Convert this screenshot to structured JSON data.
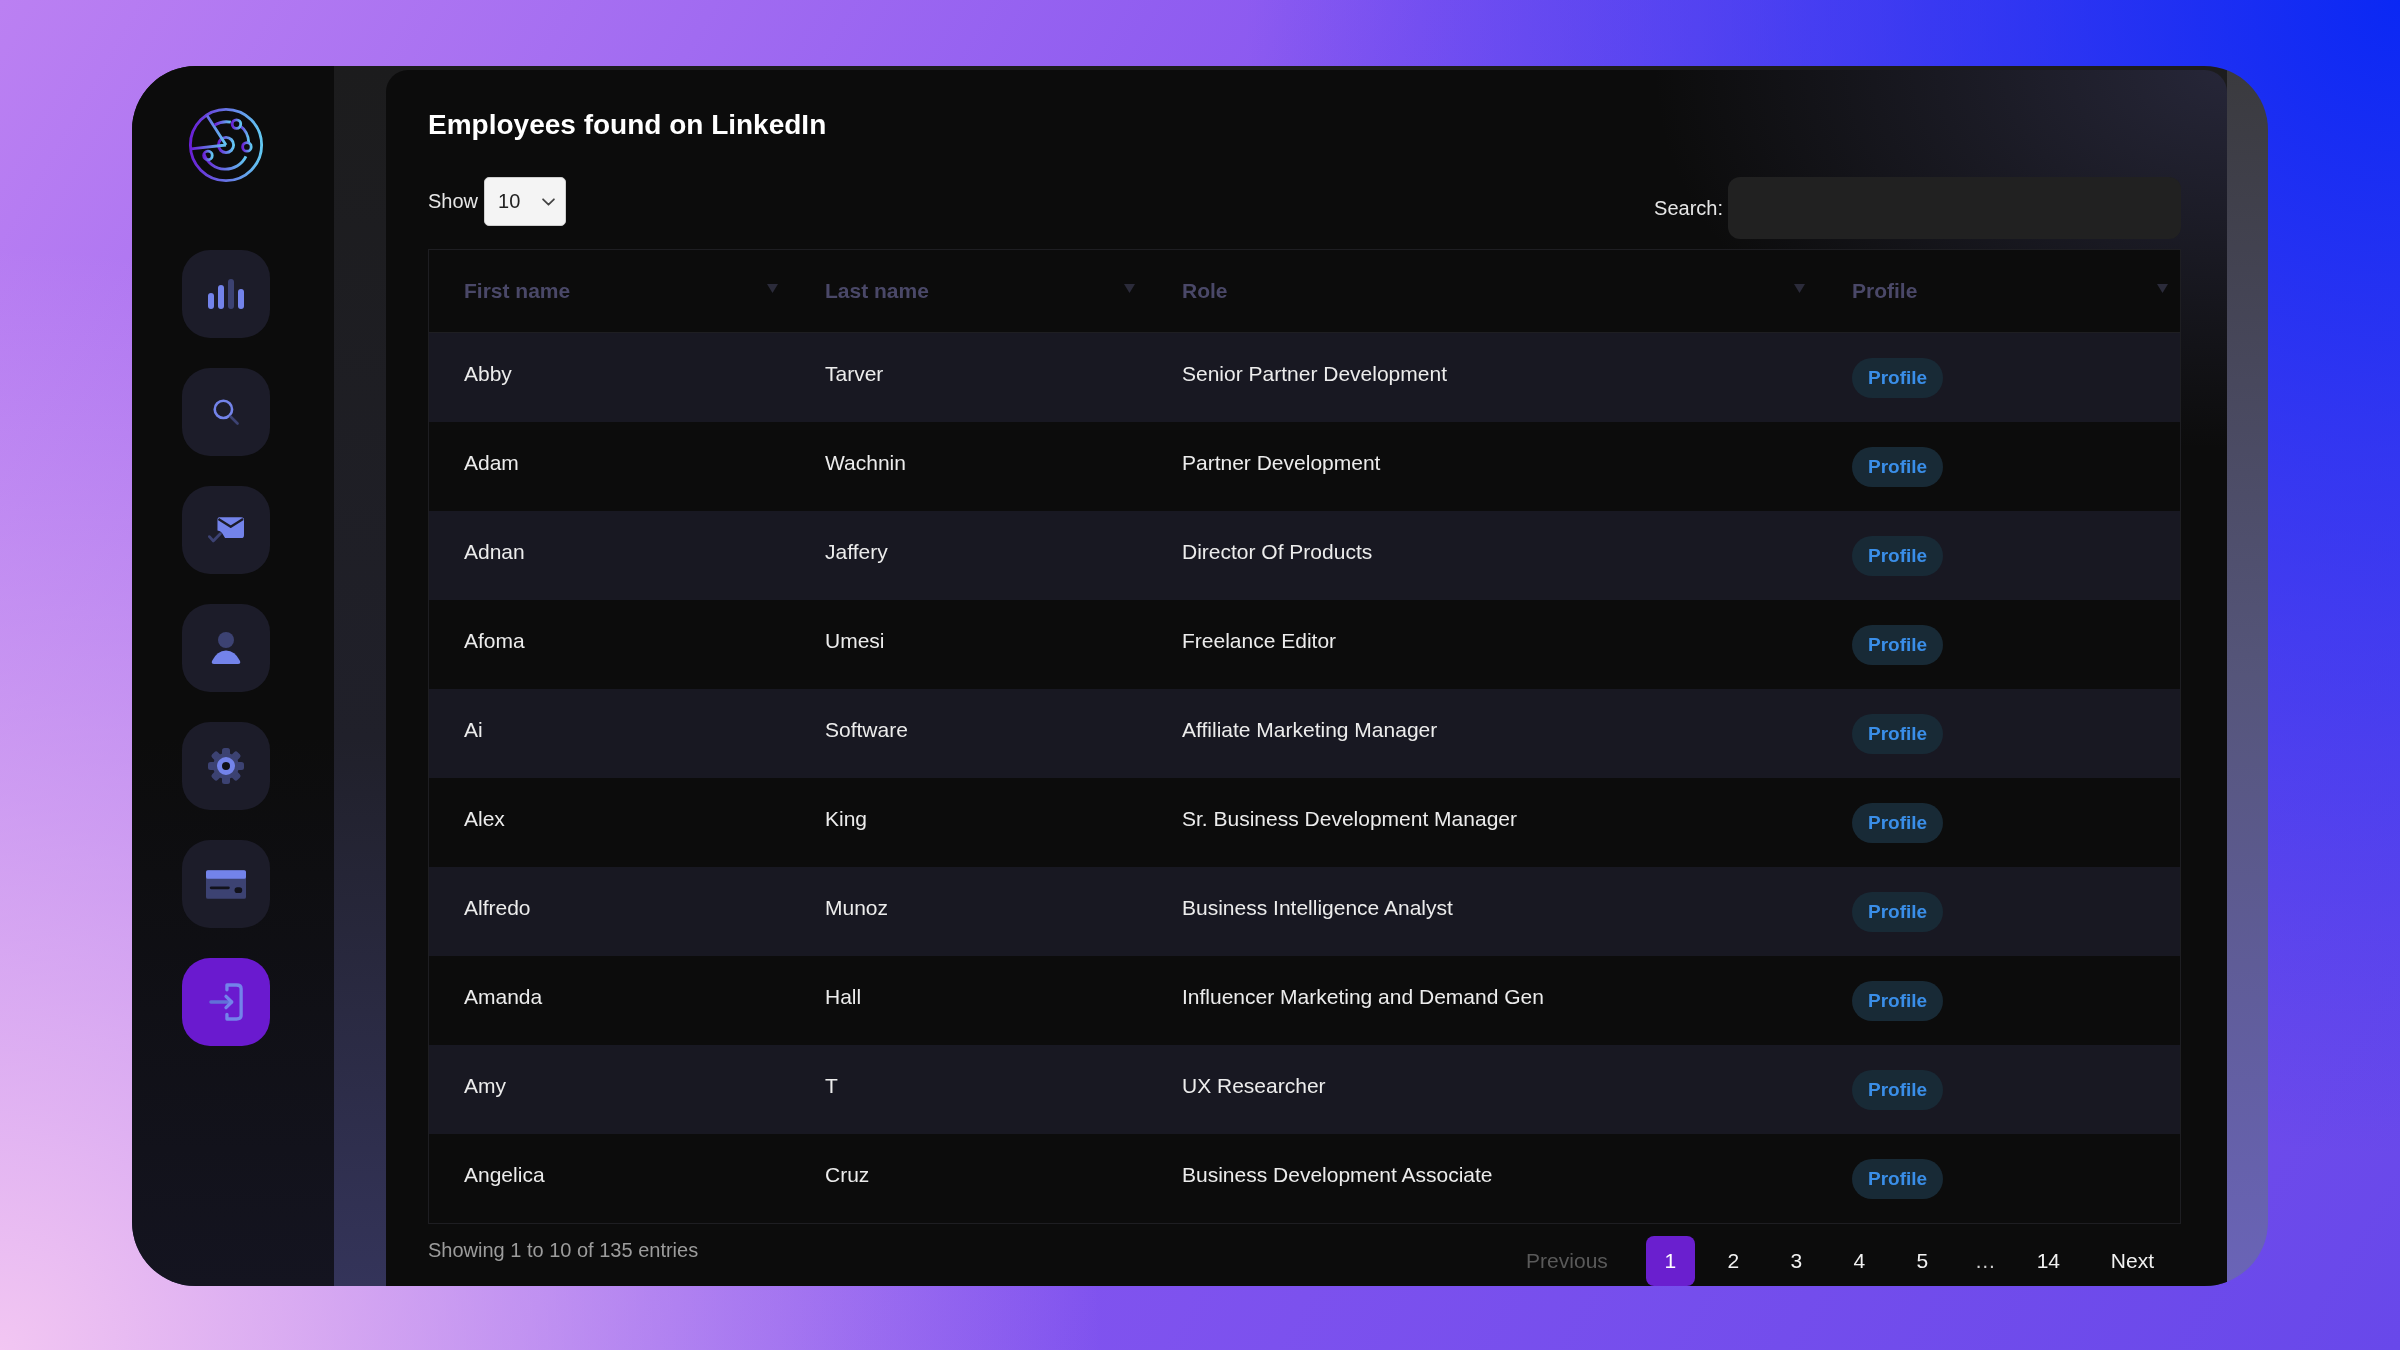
{
  "sidebar": {
    "items": [
      {
        "kind": "chart",
        "selected": false
      },
      {
        "kind": "search",
        "selected": false
      },
      {
        "kind": "mail",
        "selected": false
      },
      {
        "kind": "user",
        "selected": false
      },
      {
        "kind": "settings",
        "selected": false
      },
      {
        "kind": "card",
        "selected": false
      },
      {
        "kind": "login",
        "selected": true
      }
    ]
  },
  "title": "Employees found on LinkedIn",
  "page_size": {
    "label": "Show",
    "value": "10"
  },
  "search": {
    "label": "Search:"
  },
  "table": {
    "columns": [
      "First name",
      "Last name",
      "Role",
      "Profile"
    ],
    "rows": [
      {
        "first_name": "Abby",
        "last_name": "Tarver",
        "role": "Senior Partner Development",
        "profile": "Profile"
      },
      {
        "first_name": "Adam",
        "last_name": "Wachnin",
        "role": "Partner Development",
        "profile": "Profile"
      },
      {
        "first_name": "Adnan",
        "last_name": "Jaffery",
        "role": "Director Of Products",
        "profile": "Profile"
      },
      {
        "first_name": "Afoma",
        "last_name": "Umesi",
        "role": "Freelance Editor",
        "profile": "Profile"
      },
      {
        "first_name": "Ai",
        "last_name": "Software",
        "role": "Affiliate Marketing Manager",
        "profile": "Profile"
      },
      {
        "first_name": "Alex",
        "last_name": "King",
        "role": "Sr. Business Development Manager",
        "profile": "Profile"
      },
      {
        "first_name": "Alfredo",
        "last_name": "Munoz",
        "role": "Business Intelligence Analyst",
        "profile": "Profile"
      },
      {
        "first_name": "Amanda",
        "last_name": "Hall",
        "role": "Influencer Marketing and Demand Gen",
        "profile": "Profile"
      },
      {
        "first_name": "Amy",
        "last_name": "T",
        "role": "UX Researcher",
        "profile": "Profile"
      },
      {
        "first_name": "Angelica",
        "last_name": "Cruz",
        "role": "Business Development Associate",
        "profile": "Profile"
      }
    ]
  },
  "footer": {
    "info": "Showing 1 to 10 of 135 entries",
    "pagination": {
      "previous": {
        "label": "Previous",
        "disabled": true
      },
      "pages": [
        {
          "kind": "page",
          "label": "1",
          "selected": true
        },
        {
          "kind": "page",
          "label": "2",
          "selected": false
        },
        {
          "kind": "page",
          "label": "3",
          "selected": false
        },
        {
          "kind": "page",
          "label": "4",
          "selected": false
        },
        {
          "kind": "page",
          "label": "5",
          "selected": false
        },
        {
          "kind": "ellipsis",
          "label": "…",
          "selected": false
        },
        {
          "kind": "page",
          "label": "14",
          "selected": false
        }
      ],
      "next": {
        "label": "Next",
        "disabled": false
      }
    }
  }
}
